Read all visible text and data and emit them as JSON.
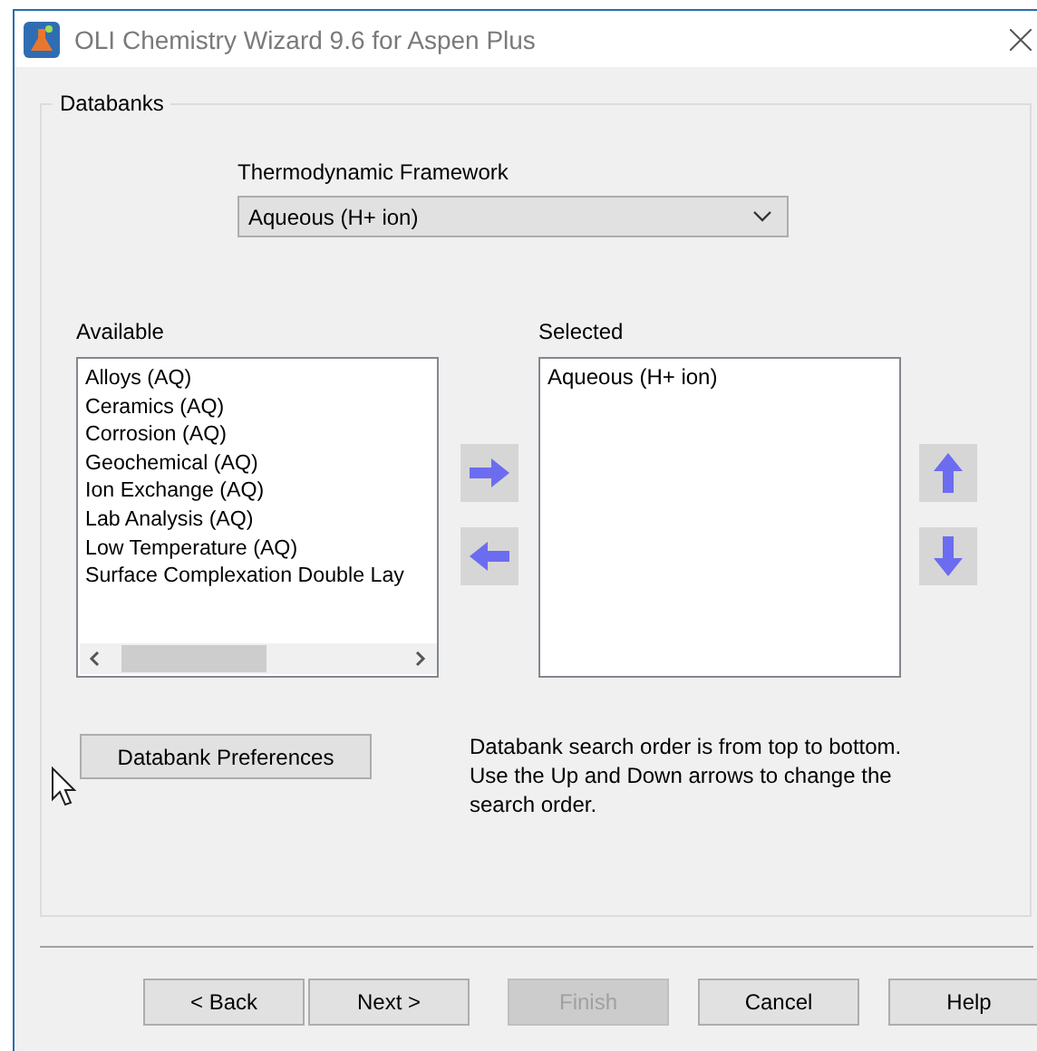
{
  "window": {
    "title": "OLI Chemistry Wizard 9.6 for Aspen Plus"
  },
  "group": {
    "title": "Databanks"
  },
  "framework": {
    "label": "Thermodynamic Framework",
    "value": "Aqueous (H+ ion)"
  },
  "available": {
    "label": "Available",
    "items": [
      "Alloys (AQ)",
      "Ceramics (AQ)",
      "Corrosion (AQ)",
      "Geochemical (AQ)",
      "Ion Exchange (AQ)",
      "Lab Analysis (AQ)",
      "Low Temperature (AQ)",
      "Surface Complexation Double Lay"
    ]
  },
  "selected": {
    "label": "Selected",
    "items": [
      "Aqueous (H+ ion)"
    ]
  },
  "preferences_button": "Databank Preferences",
  "hint": "Databank search order is from top to bottom. Use the Up and Down arrows to change the search order.",
  "buttons": [
    {
      "label": "< Back",
      "disabled": false
    },
    {
      "label": "Next >",
      "disabled": false
    },
    {
      "label": "Finish",
      "disabled": true
    },
    {
      "label": "Cancel",
      "disabled": false
    },
    {
      "label": "Help",
      "disabled": false
    }
  ]
}
